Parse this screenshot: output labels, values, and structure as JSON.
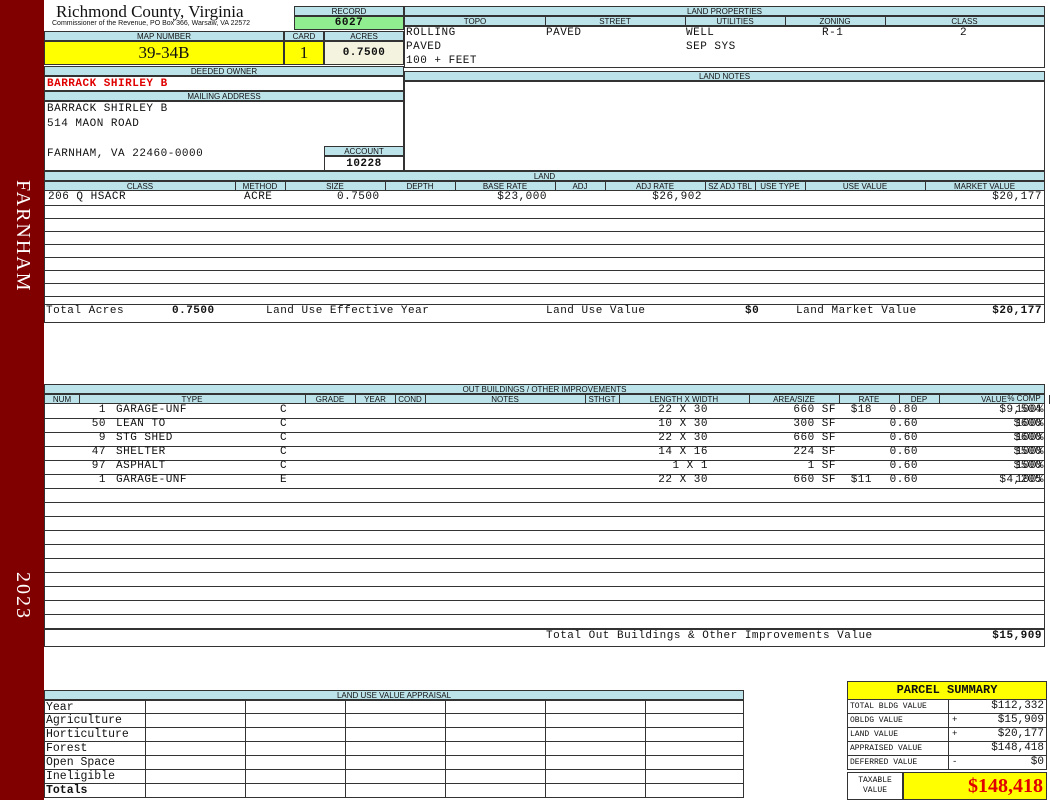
{
  "sidebar": {
    "district": "FARNHAM",
    "year": "2023"
  },
  "header": {
    "county": "Richmond County, Virginia",
    "commissioner": "Commissioner of the Revenue, PO Box 366, Warsaw, VA 22572",
    "record_label": "RECORD",
    "record": "6027",
    "map_label": "MAP NUMBER",
    "map_number": "39-34B",
    "card_label": "CARD",
    "card": "1",
    "acres_label": "ACRES",
    "acres": "0.7500"
  },
  "owner": {
    "deeded_label": "DEEDED OWNER",
    "deeded_owner": "BARRACK SHIRLEY B",
    "mailing_label": "MAILING ADDRESS",
    "line1": "BARRACK SHIRLEY B",
    "line2": "514 MAON ROAD",
    "line3": "FARNHAM, VA 22460-0000",
    "account_label": "ACCOUNT",
    "account": "10228"
  },
  "land_properties": {
    "title": "LAND PROPERTIES",
    "headers": [
      "TOPO",
      "STREET",
      "UTILITIES",
      "ZONING",
      "CLASS"
    ],
    "topo": [
      "ROLLING",
      "PAVED",
      "100 + FEET"
    ],
    "street": "PAVED",
    "utilities": [
      "WELL",
      "SEP SYS"
    ],
    "zoning": "R-1",
    "class": "2"
  },
  "land_notes": {
    "title": "LAND NOTES"
  },
  "land": {
    "title": "LAND",
    "headers": [
      "CLASS",
      "METHOD",
      "SIZE",
      "DEPTH",
      "BASE RATE",
      "ADJ",
      "ADJ RATE",
      "SZ ADJ TBL",
      "USE TYPE",
      "USE VALUE",
      "MARKET VALUE"
    ],
    "row": {
      "class": "206 Q HSACR",
      "method": "ACRE",
      "size": "0.7500",
      "base_rate": "$23,000",
      "adj_rate": "$26,902",
      "market_value": "$20,177"
    },
    "total_acres_label": "Total Acres",
    "total_acres": "0.7500",
    "effective_year_label": "Land Use Effective Year",
    "use_value_label": "Land Use Value",
    "use_value": "$0",
    "market_value_label": "Land Market Value",
    "market_value": "$20,177"
  },
  "outbuildings": {
    "title": "OUT BUILDINGS / OTHER IMPROVEMENTS",
    "headers": [
      "NUM",
      "TYPE",
      "GRADE",
      "YEAR",
      "COND",
      "NOTES",
      "STHGT",
      "LENGTH X WIDTH",
      "AREA/SIZE",
      "RATE",
      "DEP",
      "VALUE",
      "% COMP"
    ],
    "rows": [
      {
        "num": "1",
        "type": "GARAGE-UNF",
        "grade": "C",
        "lw": "22 X 30",
        "area": "660 SF",
        "rate": "$18",
        "dep": "0.80",
        "value": "$9,504",
        "comp": "100%"
      },
      {
        "num": "50",
        "type": "LEAN TO",
        "grade": "C",
        "lw": "10 X 30",
        "area": "300 SF",
        "rate": "",
        "dep": "0.60",
        "value": "$600",
        "comp": "100%"
      },
      {
        "num": "9",
        "type": "STG SHED",
        "grade": "C",
        "lw": "22 X 30",
        "area": "660 SF",
        "rate": "",
        "dep": "0.60",
        "value": "$600",
        "comp": "100%"
      },
      {
        "num": "47",
        "type": "SHELTER",
        "grade": "C",
        "lw": "14 X 16",
        "area": "224 SF",
        "rate": "",
        "dep": "0.60",
        "value": "$500",
        "comp": "100%"
      },
      {
        "num": "97",
        "type": "ASPHALT",
        "grade": "C",
        "lw": "1 X 1",
        "area": "1 SF",
        "rate": "",
        "dep": "0.60",
        "value": "$500",
        "comp": "100%"
      },
      {
        "num": "1",
        "type": "GARAGE-UNF",
        "grade": "E",
        "lw": "22 X 30",
        "area": "660 SF",
        "rate": "$11",
        "dep": "0.60",
        "value": "$4,205",
        "comp": "100%"
      }
    ],
    "total_label": "Total Out Buildings & Other Improvements Value",
    "total": "$15,909"
  },
  "land_use": {
    "title": "LAND USE VALUE APPRAISAL",
    "rows": [
      "Year",
      "Agriculture",
      "Horticulture",
      "Forest",
      "Open Space",
      "Ineligible",
      "Totals"
    ]
  },
  "summary": {
    "title": "PARCEL SUMMARY",
    "rows": [
      {
        "label": "TOTAL BLDG VALUE",
        "op": "",
        "value": "$112,332"
      },
      {
        "label": "OBLDG VALUE",
        "op": "+",
        "value": "$15,909"
      },
      {
        "label": "LAND VALUE",
        "op": "+",
        "value": "$20,177"
      },
      {
        "label": "APPRAISED VALUE",
        "op": "",
        "value": "$148,418"
      },
      {
        "label": "DEFERRED VALUE",
        "op": "-",
        "value": "$0"
      }
    ],
    "taxable_label_1": "TAXABLE",
    "taxable_label_2": "VALUE",
    "taxable": "$148,418"
  },
  "colors": {
    "sidebar": "#800000",
    "header_bg": "#bde3ea",
    "highlight": "#ffff00",
    "record_bg": "#90ee90",
    "accent_red": "#e00000"
  }
}
